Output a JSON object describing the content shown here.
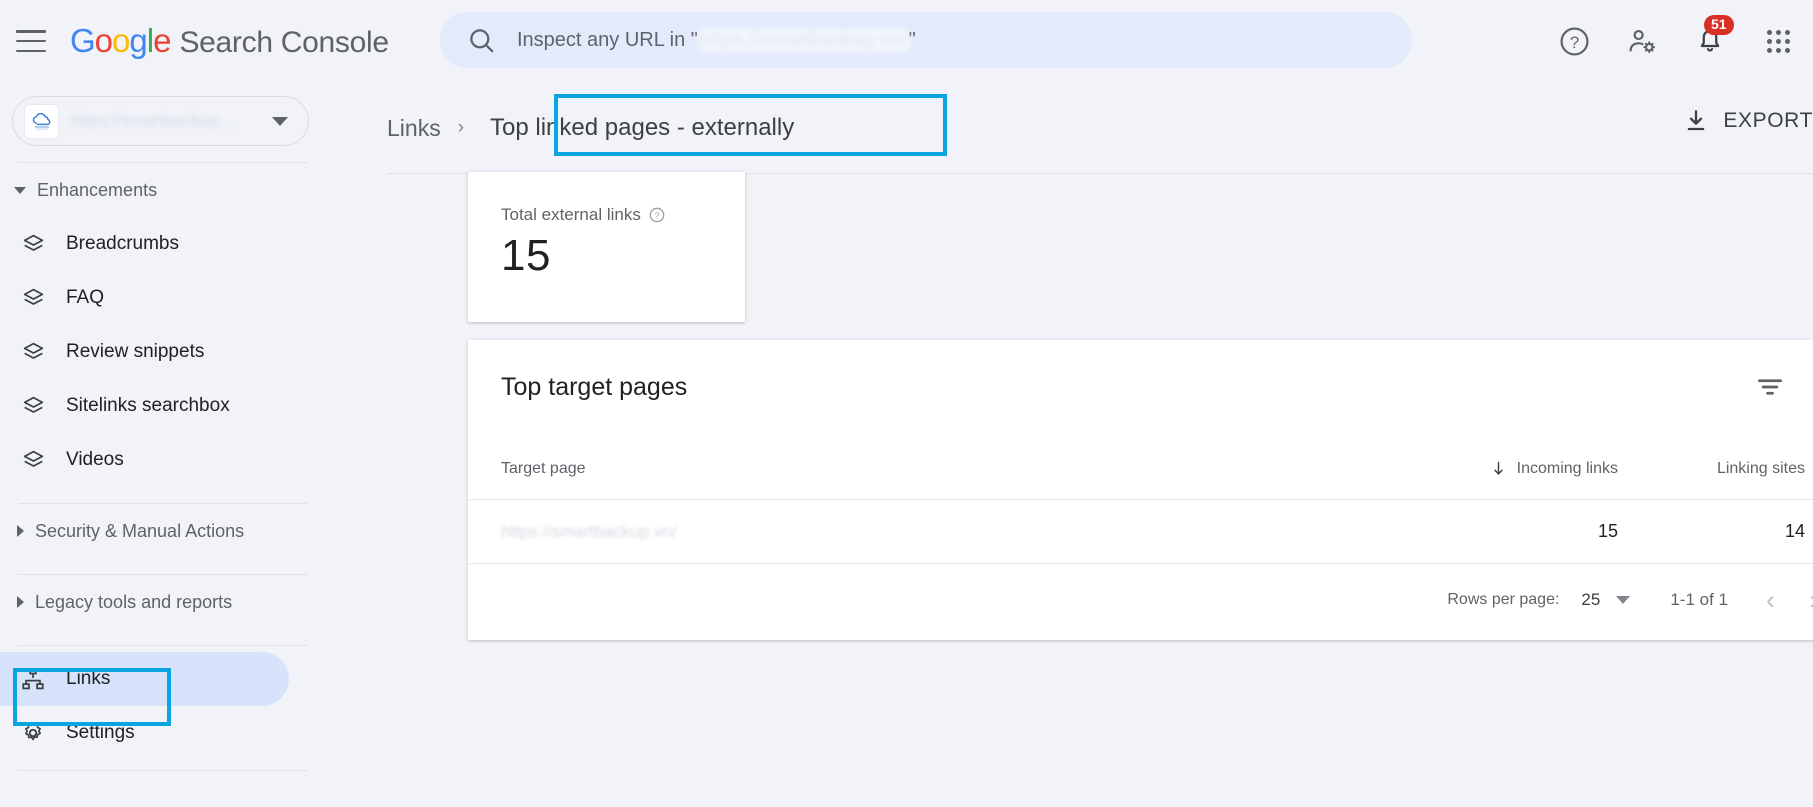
{
  "header": {
    "menu_icon": "hamburger-menu-icon",
    "logo_google": [
      "G",
      "o",
      "o",
      "g",
      "l",
      "e"
    ],
    "brand": "Search Console",
    "search": {
      "icon": "search-icon",
      "placeholder_prefix": "Inspect any URL in \"",
      "placeholder_url_redacted": "https://smartbackup.vn/",
      "placeholder_suffix": "\""
    },
    "icons": [
      {
        "name": "help-icon",
        "label": "?"
      },
      {
        "name": "account-settings-icon",
        "label": ""
      },
      {
        "name": "notifications-bell-icon",
        "badge": "51"
      },
      {
        "name": "google-apps-grid-icon",
        "label": ""
      }
    ]
  },
  "sidebar": {
    "property_selector": {
      "favicon": "site-favicon",
      "url_redacted": "https://smartbackup...",
      "caret": "chevron-down-icon"
    },
    "groups": [
      {
        "label": "Enhancements",
        "state": "expanded"
      },
      {
        "label": "Security & Manual Actions",
        "state": "collapsed"
      },
      {
        "label": "Legacy tools and reports",
        "state": "collapsed"
      }
    ],
    "enhancement_items": [
      {
        "label": "Breadcrumbs",
        "icon": "layers-icon"
      },
      {
        "label": "FAQ",
        "icon": "layers-icon"
      },
      {
        "label": "Review snippets",
        "icon": "layers-icon"
      },
      {
        "label": "Sitelinks searchbox",
        "icon": "layers-icon"
      },
      {
        "label": "Videos",
        "icon": "layers-icon"
      }
    ],
    "bottom_items": [
      {
        "label": "Links",
        "icon": "links-sitemap-icon",
        "active": true
      },
      {
        "label": "Settings",
        "icon": "gear-icon",
        "active": false
      }
    ]
  },
  "breadcrumb": {
    "root": "Links",
    "separator": "›",
    "current": "Top linked pages - externally"
  },
  "export": {
    "icon": "download-icon",
    "label": "EXPORT"
  },
  "kpi_card": {
    "label": "Total external links",
    "help_icon": "help-circle-icon",
    "value": "15"
  },
  "table": {
    "title": "Top target pages",
    "filter_icon": "filter-icon",
    "columns": {
      "target_page": "Target page",
      "incoming_links": "Incoming links",
      "linking_sites": "Linking sites",
      "sort_icon": "arrow-down-icon"
    },
    "rows": [
      {
        "target_page_redacted": "https://smartbackup.vn/",
        "incoming_links": "15",
        "linking_sites": "14"
      }
    ],
    "footer": {
      "rows_per_page_label": "Rows per page:",
      "rows_per_page_value": "25",
      "rows_per_page_caret": "chevron-down-icon",
      "range": "1-1 of 1",
      "prev_icon": "chevron-left-icon",
      "next_icon": "chevron-right-icon"
    }
  },
  "colors": {
    "annotation": "#0aa5e0",
    "page_bg": "#f1f3f9",
    "active_nav": "#d7e3fb",
    "badge_red": "#d93025",
    "google_blue": "#4285F4",
    "google_red": "#EA4335",
    "google_yellow": "#FBBC05",
    "google_green": "#34A853"
  }
}
